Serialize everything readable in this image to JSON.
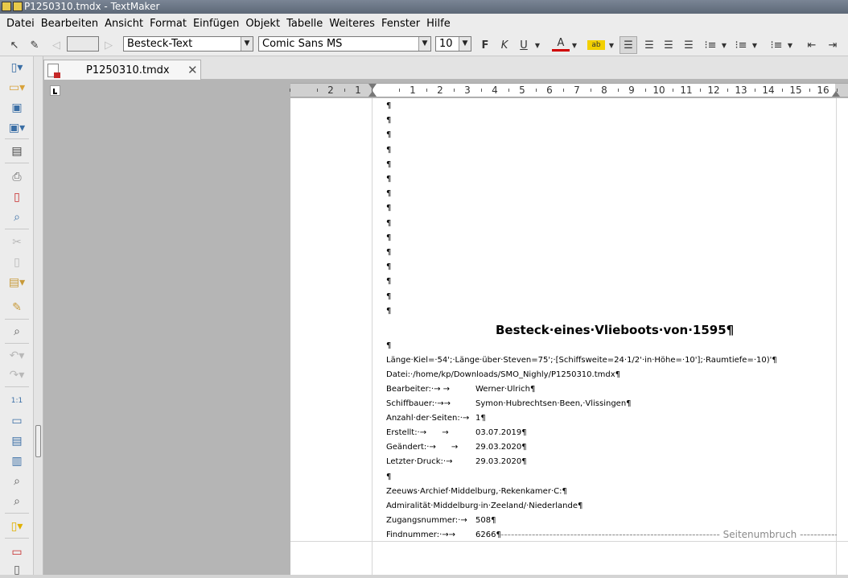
{
  "window": {
    "title": "P1250310.tmdx - TextMaker"
  },
  "menu": [
    "Datei",
    "Bearbeiten",
    "Ansicht",
    "Format",
    "Einfügen",
    "Objekt",
    "Tabelle",
    "Weiteres",
    "Fenster",
    "Hilfe"
  ],
  "toolbar": {
    "paragraph_style": "Besteck-Text",
    "font_name": "Comic Sans MS",
    "font_size": "10",
    "bold_label": "F",
    "italic_label": "K",
    "underline_label": "U",
    "font_color_label": "A",
    "highlight_label": "ab"
  },
  "tab": {
    "label": "P1250310.tmdx",
    "close": "✕"
  },
  "ruler": {
    "labels": [
      "2",
      "1",
      "1",
      "1",
      "2",
      "3",
      "4",
      "5",
      "6",
      "7",
      "8",
      "9",
      "10",
      "11",
      "12",
      "13",
      "14",
      "15",
      "16"
    ]
  },
  "document": {
    "pilcrow": "¶",
    "title": "Besteck·eines·Vlieboots·von·1595¶",
    "empty_after_title": "¶",
    "dims": "Länge·Kiel=·54';·Länge·über·Steven=75';·[Schiffsweite=24·1/2'·in·Höhe=·10'];·Raumtiefe=·10)'¶",
    "file": "Datei:·/home/kp/Downloads/SMO_Nighly/P1250310.tmdx¶",
    "meta": [
      {
        "label": "Bearbeiter:·→ →",
        "value": "Werner·Ulrich¶"
      },
      {
        "label": "Schiffbauer:·→→",
        "value": "Symon·Hubrechtsen·Been,·Vlissingen¶"
      },
      {
        "label": "Anzahl·der·Seiten:·→",
        "value": "1¶"
      },
      {
        "label": "Erstellt:·→      →",
        "value": "03.07.2019¶"
      },
      {
        "label": "Geändert:·→      →",
        "value": "29.03.2020¶"
      },
      {
        "label": "Letzter·Druck:·→",
        "value": "29.03.2020¶"
      }
    ],
    "empty_before_archive": "¶",
    "archive1": "Zeeuws·Archief·Middelburg,·Rekenkamer·C:¶",
    "archive2": "Admiralität·Middelburg·in·Zeeland/·Niederlande¶",
    "access": {
      "label": "Zugangsnummer:·→",
      "value": "508¶"
    },
    "find": {
      "label": "Findnummer:·→→",
      "value": "6266¶"
    },
    "page_break": "Seitenumbruch"
  }
}
